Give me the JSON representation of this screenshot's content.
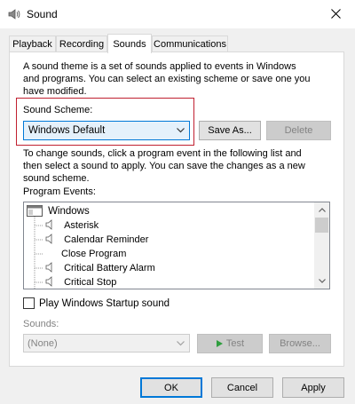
{
  "window": {
    "title": "Sound"
  },
  "tabs": [
    {
      "label": "Playback"
    },
    {
      "label": "Recording"
    },
    {
      "label": "Sounds"
    },
    {
      "label": "Communications"
    }
  ],
  "description": [
    "A sound theme is a set of sounds applied to events in Windows",
    "and programs.  You can select an existing scheme or save one you",
    "have modified."
  ],
  "scheme": {
    "label": "Sound Scheme:",
    "selected": "Windows Default",
    "save_as": "Save As...",
    "delete": "Delete"
  },
  "instructions": [
    "To change sounds, click a program event in the following list and",
    "then select a sound to apply.  You can save the changes as a new",
    "sound scheme."
  ],
  "events": {
    "label": "Program Events:",
    "root": "Windows",
    "items": [
      {
        "label": "Asterisk",
        "has_sound": true
      },
      {
        "label": "Calendar Reminder",
        "has_sound": true
      },
      {
        "label": "Close Program",
        "has_sound": false
      },
      {
        "label": "Critical Battery Alarm",
        "has_sound": true
      },
      {
        "label": "Critical Stop",
        "has_sound": true
      }
    ]
  },
  "startup": {
    "label": "Play Windows Startup sound",
    "checked": false
  },
  "sounds": {
    "label": "Sounds:",
    "selected": "(None)",
    "test": "Test",
    "browse": "Browse..."
  },
  "footer": {
    "ok": "OK",
    "cancel": "Cancel",
    "apply": "Apply"
  },
  "icons": {
    "app": "speaker-icon",
    "close": "close-icon",
    "event": "speaker-icon",
    "dropdown": "chevron-down-icon",
    "play": "play-icon"
  },
  "colors": {
    "accent": "#0078d7",
    "highlight": "#c02030",
    "disabled_text": "#838383"
  }
}
